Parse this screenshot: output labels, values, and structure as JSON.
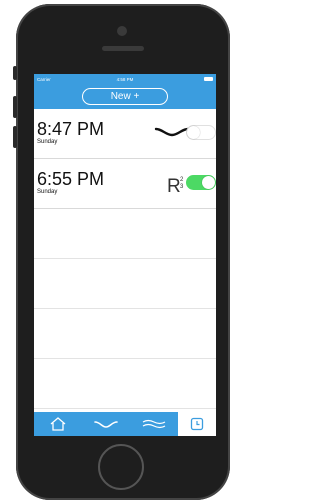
{
  "status_bar": {
    "carrier": "Carrier",
    "time": "4:58 PM"
  },
  "nav": {
    "new_button_label": "New +"
  },
  "alarms": [
    {
      "time": "8:47 PM",
      "day": "Sunday",
      "sound_icon": "wave-icon",
      "enabled": false
    },
    {
      "time": "6:55 PM",
      "day": "Sunday",
      "sound_icon": "r-squared-icon",
      "enabled": true
    }
  ],
  "tab_bar": {
    "tabs": [
      {
        "icon": "home-icon"
      },
      {
        "icon": "wave-icon"
      },
      {
        "icon": "ocean-waves-icon"
      },
      {
        "icon": "clock-icon",
        "active": true
      }
    ]
  },
  "colors": {
    "accent": "#3b9ddf",
    "toggle_on": "#4cd964",
    "phone_body": "#1e1e1e"
  }
}
